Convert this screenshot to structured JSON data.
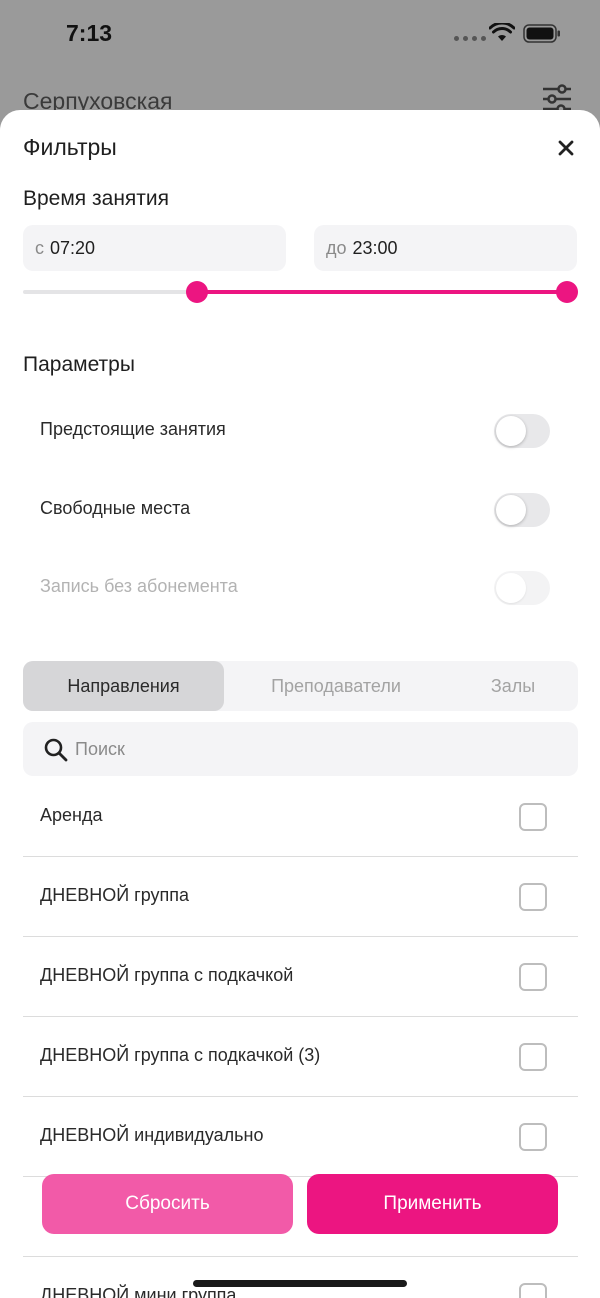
{
  "status_bar": {
    "time": "7:13"
  },
  "background": {
    "title": "Серпуховская",
    "filter_icon": "sliders-icon"
  },
  "sheet": {
    "title": "Фильтры",
    "close_icon": "close-icon",
    "time_section": {
      "title": "Время занятия",
      "from_prefix": "с",
      "from_value": "07:20",
      "to_prefix": "до",
      "to_value": "23:00",
      "range_fraction": {
        "start": 0.305,
        "end": 1.0
      },
      "accent_color": "#ec1581"
    },
    "params_section": {
      "title": "Параметры",
      "toggles": [
        {
          "label": "Предстоящие занятия",
          "on": false,
          "enabled": true
        },
        {
          "label": "Свободные места",
          "on": false,
          "enabled": true
        },
        {
          "label": "Запись без абонемента",
          "on": false,
          "enabled": false
        }
      ]
    },
    "tabs": [
      {
        "label": "Направления",
        "active": true
      },
      {
        "label": "Преподаватели",
        "active": false
      },
      {
        "label": "Залы",
        "active": false
      }
    ],
    "search": {
      "placeholder": "Поиск",
      "value": "",
      "icon": "search-icon"
    },
    "list": [
      {
        "label": "Аренда",
        "checked": false
      },
      {
        "label": "ДНЕВНОЙ группа",
        "checked": false
      },
      {
        "label": "ДНЕВНОЙ группа с подкачкой",
        "checked": false
      },
      {
        "label": "ДНЕВНОЙ группа с подкачкой (3)",
        "checked": false
      },
      {
        "label": "ДНЕВНОЙ индивидуально",
        "checked": false
      },
      {
        "label": "",
        "checked": false
      },
      {
        "label": "ДНЕВНОЙ мини группа",
        "checked": false
      }
    ],
    "buttons": {
      "reset": "Сбросить",
      "apply": "Применить"
    }
  }
}
